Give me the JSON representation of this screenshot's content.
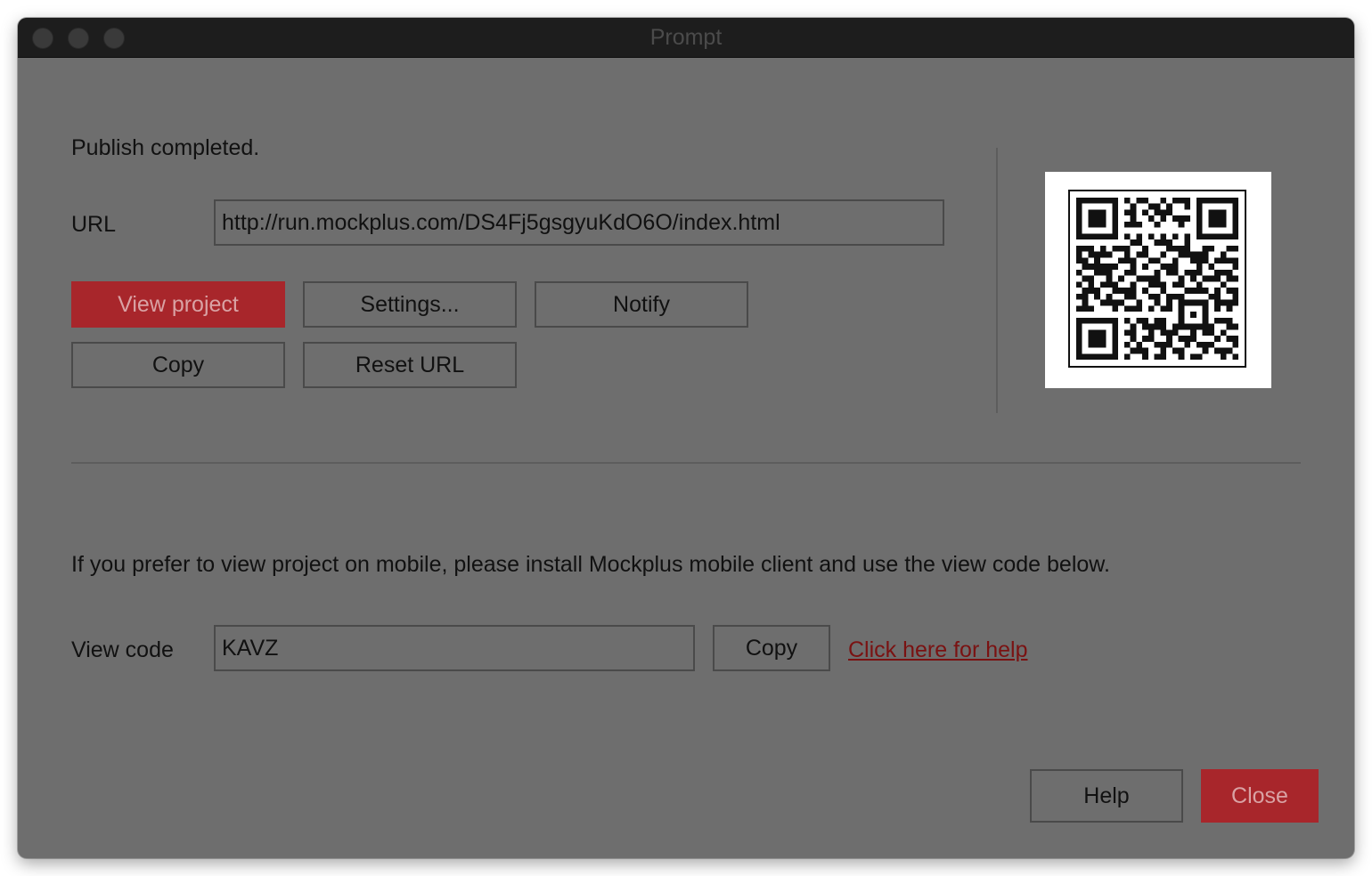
{
  "window": {
    "title": "Prompt"
  },
  "status": "Publish completed.",
  "url_section": {
    "label": "URL",
    "value": "http://run.mockplus.com/DS4Fj5gsgyuKdO6O/index.html"
  },
  "buttons": {
    "view_project": "View project",
    "settings": "Settings...",
    "notify": "Notify",
    "copy": "Copy",
    "reset_url": "Reset URL"
  },
  "mobile_info": "If you prefer to view project on mobile, please install Mockplus mobile client and use the view code below.",
  "view_code": {
    "label": "View code",
    "value": "KAVZ",
    "copy": "Copy",
    "help_link": "Click here for help"
  },
  "footer": {
    "help": "Help",
    "close": "Close"
  },
  "colors": {
    "window_bg": "#6e6e6e",
    "titlebar_bg": "#1d1d1d",
    "accent": "#a8262b",
    "link": "#7a1212"
  },
  "icons": {
    "qr": "qr-code"
  }
}
